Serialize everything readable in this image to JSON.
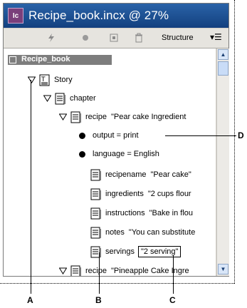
{
  "window": {
    "app_badge": "Ic",
    "title": "Recipe_book.incx @ 27%"
  },
  "toolbar": {
    "structure_label": "Structure",
    "icons": [
      "lightning-icon",
      "circle-icon",
      "add-element-icon",
      "trash-icon",
      "panel-menu-icon"
    ]
  },
  "tree": {
    "root": "Recipe_book",
    "story": "Story",
    "chapter": "chapter",
    "recipe1": {
      "tag": "recipe",
      "value": "\"Pear cake Ingredient"
    },
    "attr_output": "output = print",
    "attr_language": "language = English",
    "children": [
      {
        "tag": "recipename",
        "value": "\"Pear cake\""
      },
      {
        "tag": "ingredients",
        "value": "\"2 cups flour"
      },
      {
        "tag": "instructions",
        "value": "\"Bake in flou"
      },
      {
        "tag": "notes",
        "value": "\"You can substitute"
      },
      {
        "tag": "servings",
        "value": "\"2 serving\""
      }
    ],
    "recipe2": {
      "tag": "recipe",
      "value": "\"Pineapple Cake Ingre"
    }
  },
  "callouts": {
    "a": "A",
    "b": "B",
    "c": "C",
    "d": "D"
  },
  "colors": {
    "titlebar": "#1f559a",
    "root_row": "#7d7d7d",
    "panel": "#d4d0c8"
  }
}
